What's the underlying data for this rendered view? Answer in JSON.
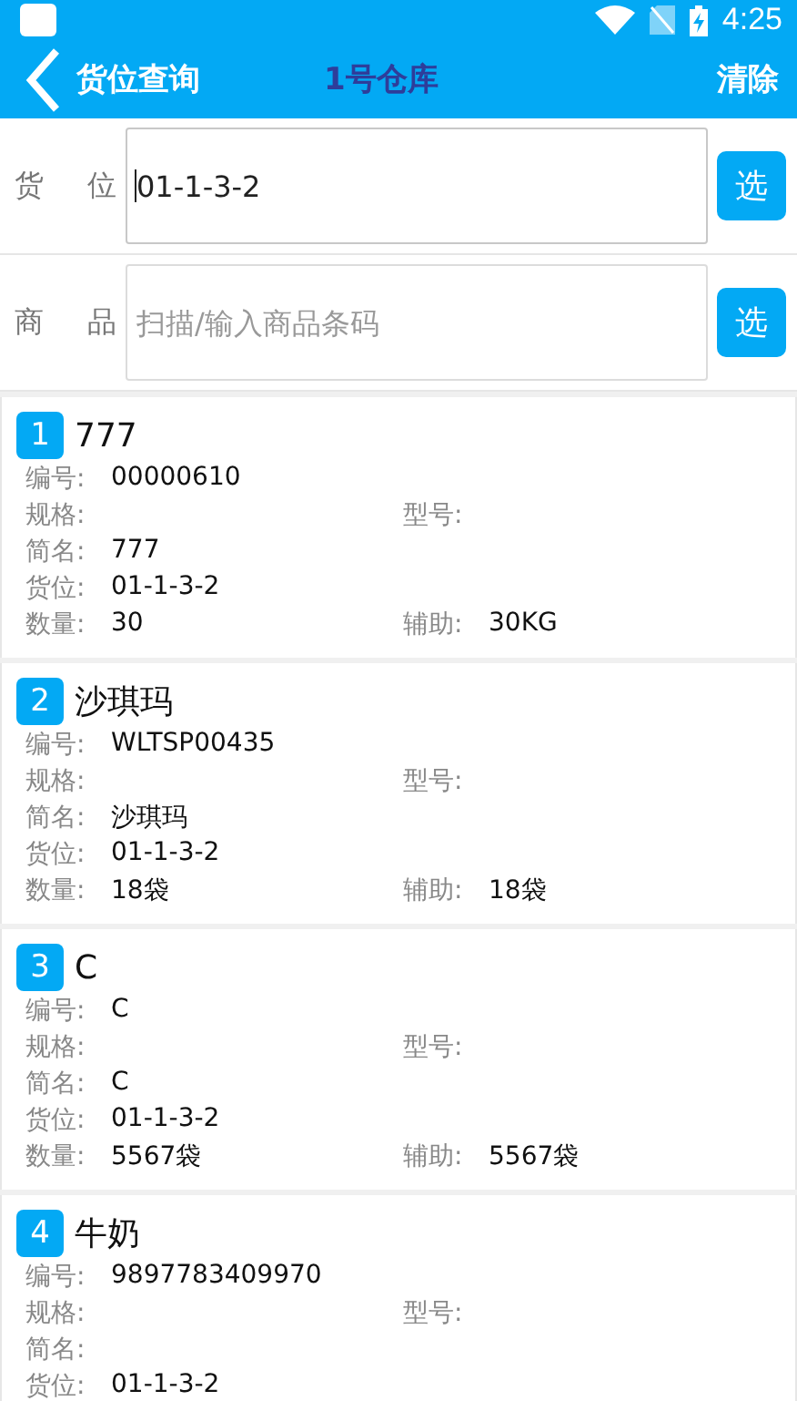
{
  "status_bar": {
    "time": "4:25"
  },
  "header": {
    "back_label": "货位查询",
    "warehouse": "1号仓库",
    "clear": "清除"
  },
  "form": [
    {
      "label": "货 位",
      "value": "01-1-3-2",
      "focused": true,
      "button": "选"
    },
    {
      "label": "商 品",
      "placeholder": "扫描/输入商品条码",
      "focused": false,
      "button": "选"
    }
  ],
  "cards": [
    {
      "index": "1",
      "name": "777",
      "rows": [
        {
          "left": {
            "label": "编号:",
            "value": "00000610"
          }
        },
        {
          "left": {
            "label": "规格:"
          },
          "right": {
            "label": "型号:"
          }
        },
        {
          "left": {
            "label": "简名:",
            "value": "777"
          }
        },
        {
          "left": {
            "label": "货位:",
            "value": "01-1-3-2"
          }
        },
        {
          "left": {
            "label": "数量:",
            "value": "30"
          },
          "right": {
            "label": "辅助:",
            "value": "30KG"
          }
        }
      ]
    },
    {
      "index": "2",
      "name": "沙琪玛",
      "rows": [
        {
          "left": {
            "label": "编号:",
            "value": "WLTSP00435"
          }
        },
        {
          "left": {
            "label": "规格:"
          },
          "right": {
            "label": "型号:"
          }
        },
        {
          "left": {
            "label": "简名:",
            "value": "沙琪玛"
          }
        },
        {
          "left": {
            "label": "货位:",
            "value": "01-1-3-2"
          }
        },
        {
          "left": {
            "label": "数量:",
            "value": "18袋"
          },
          "right": {
            "label": "辅助:",
            "value": "18袋"
          }
        }
      ]
    },
    {
      "index": "3",
      "name": "C",
      "rows": [
        {
          "left": {
            "label": "编号:",
            "value": "C"
          }
        },
        {
          "left": {
            "label": "规格:"
          },
          "right": {
            "label": "型号:"
          }
        },
        {
          "left": {
            "label": "简名:",
            "value": "C"
          }
        },
        {
          "left": {
            "label": "货位:",
            "value": "01-1-3-2"
          }
        },
        {
          "left": {
            "label": "数量:",
            "value": "5567袋"
          },
          "right": {
            "label": "辅助:",
            "value": "5567袋"
          }
        }
      ]
    },
    {
      "index": "4",
      "name": "牛奶",
      "rows": [
        {
          "left": {
            "label": "编号:",
            "value": "9897783409970"
          }
        },
        {
          "left": {
            "label": "规格:"
          },
          "right": {
            "label": "型号:"
          }
        },
        {
          "left": {
            "label": "简名:"
          }
        },
        {
          "left": {
            "label": "货位:",
            "value": "01-1-3-2"
          }
        }
      ]
    }
  ]
}
